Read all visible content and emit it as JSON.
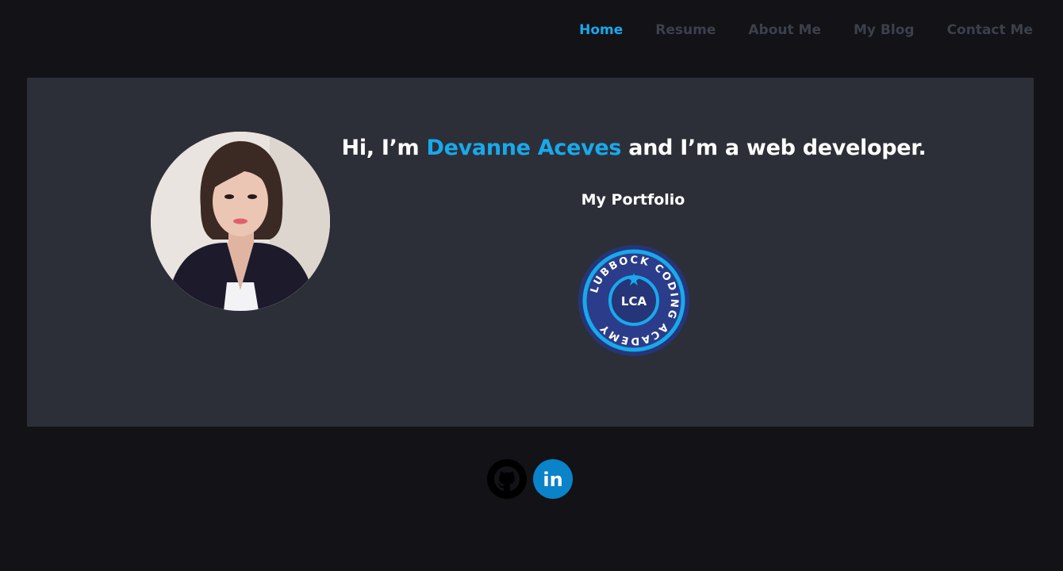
{
  "nav": {
    "items": [
      {
        "label": "Home",
        "active": true
      },
      {
        "label": "Resume",
        "active": false
      },
      {
        "label": "About Me",
        "active": false
      },
      {
        "label": "My Blog",
        "active": false
      },
      {
        "label": "Contact Me",
        "active": false
      }
    ]
  },
  "hero": {
    "headline_prefix": "Hi, I’m ",
    "name": "Devanne Aceves",
    "headline_suffix": " and I’m a web developer.",
    "subtitle": "My Portfolio",
    "badge": {
      "ring_text": "LUBBOCK CODING ACADEMY",
      "center_text": "LCA"
    }
  },
  "social": {
    "github_icon": "github-icon",
    "linkedin_icon": "linkedin-icon",
    "linkedin_text": "in"
  },
  "colors": {
    "accent": "#18a9ec",
    "page_bg": "#121217",
    "card_bg": "#2d2f38",
    "nav_inactive": "#3c404b",
    "linkedin": "#0a83c8"
  }
}
